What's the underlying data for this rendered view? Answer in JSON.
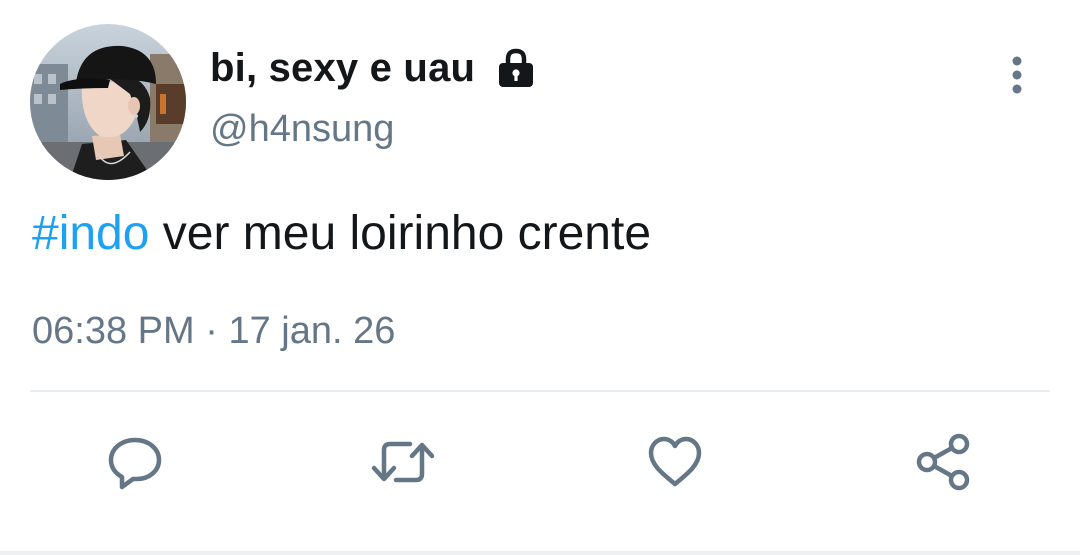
{
  "author": {
    "display_name": "bi, sexy e uau",
    "handle": "@h4nsung",
    "protected": true,
    "avatar_icon": "profile-photo"
  },
  "tweet": {
    "hashtag": "#indo",
    "text": " ver meu loirinho crente",
    "time": "06:38 PM",
    "separator": " · ",
    "date": "17 jan. 26"
  },
  "icons": {
    "more": "more-vertical-icon",
    "lock": "lock-icon",
    "reply": "reply-icon",
    "retweet": "retweet-icon",
    "like": "heart-icon",
    "share": "share-icon"
  },
  "colors": {
    "text": "#14171a",
    "secondary": "#657786",
    "link": "#1da1f2",
    "divider": "#e6ecf0"
  }
}
